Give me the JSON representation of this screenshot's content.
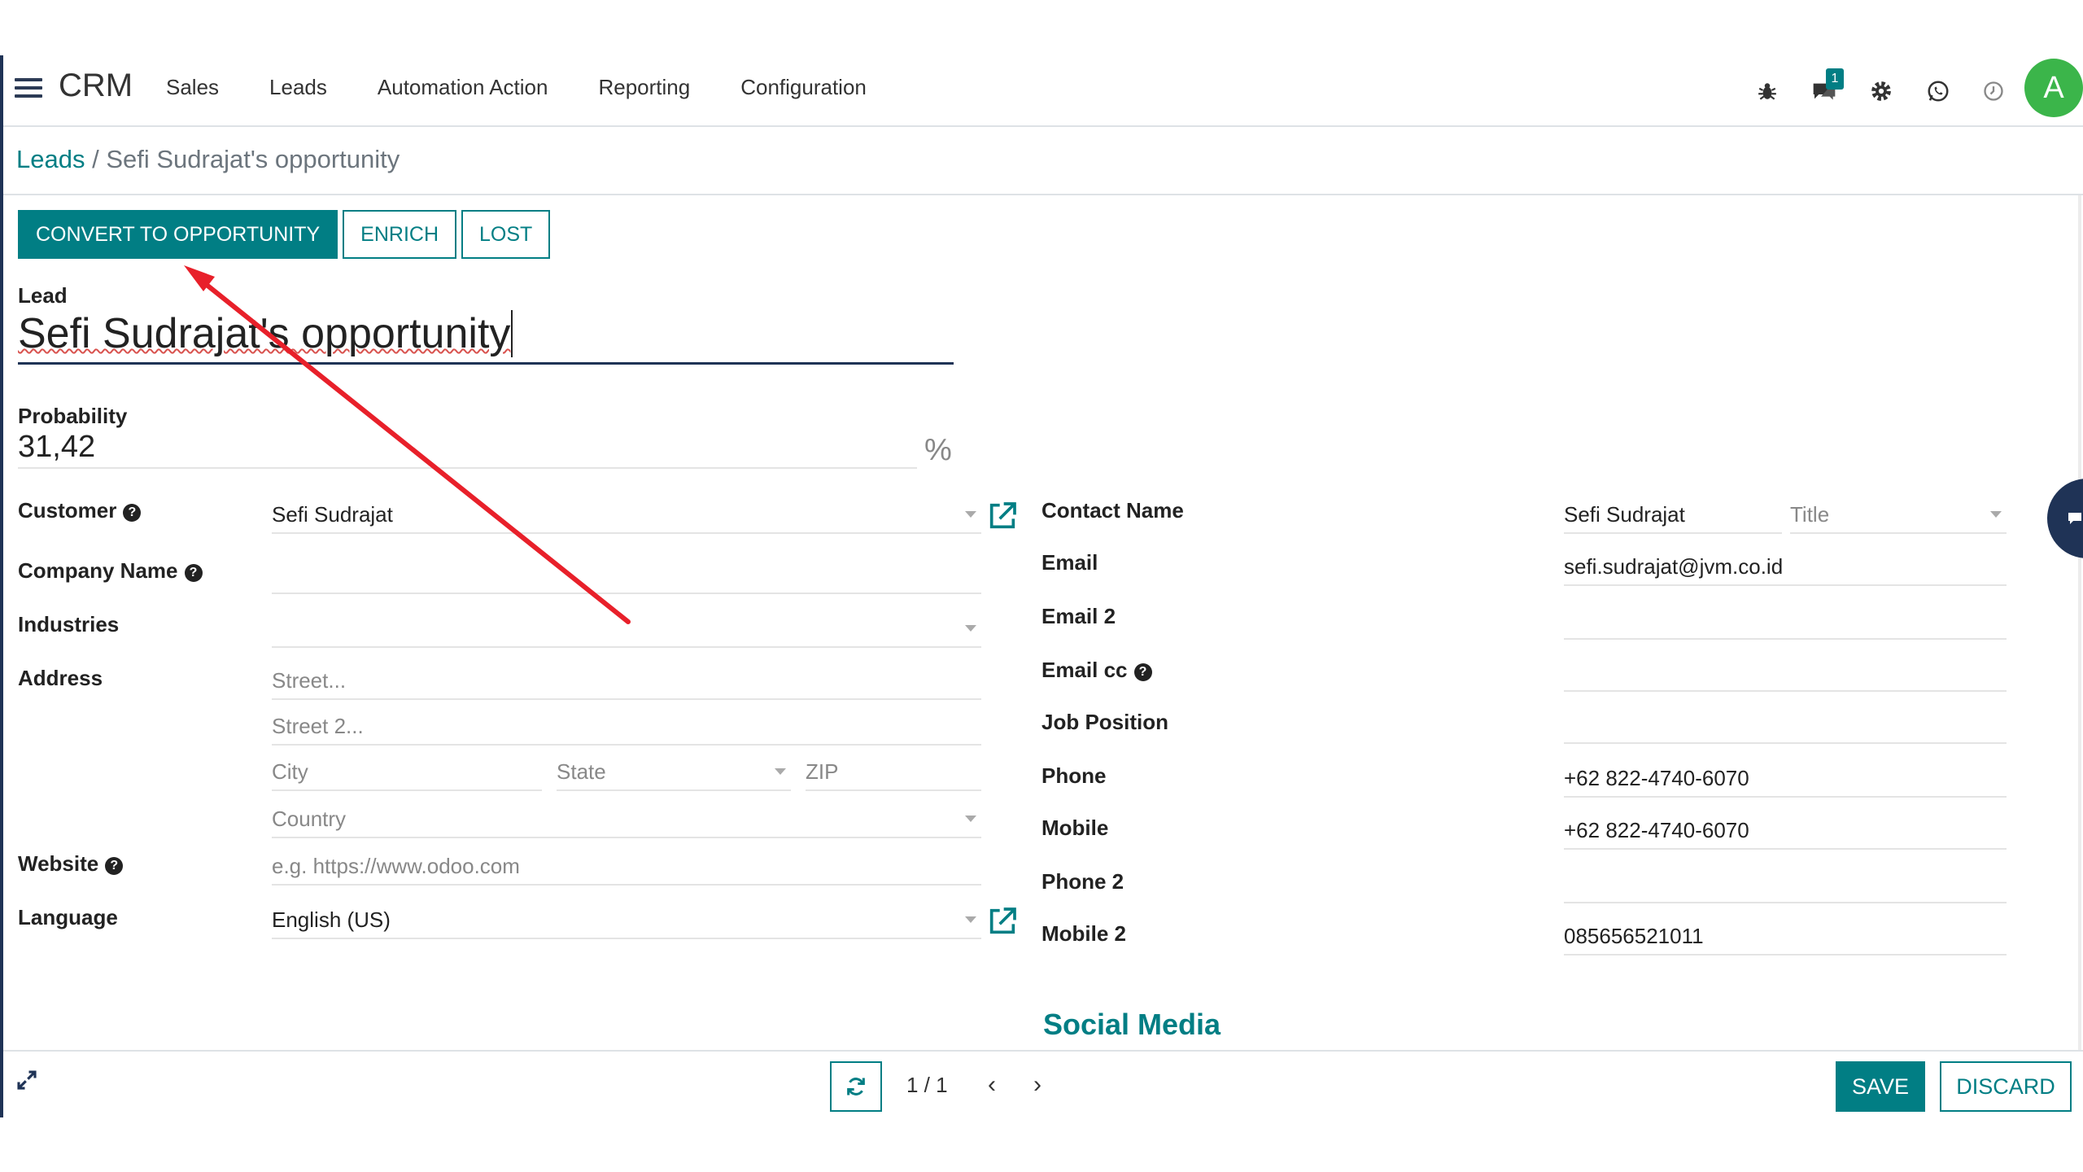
{
  "app": {
    "brand": "CRM",
    "menu": [
      "Sales",
      "Leads",
      "Automation Action",
      "Reporting",
      "Configuration"
    ],
    "avatar_letter": "A",
    "messages_count": "1"
  },
  "breadcrumb": {
    "parent": "Leads",
    "separator": "/",
    "current": "Sefi Sudrajat's opportunity"
  },
  "statusbar": {
    "convert": "CONVERT TO OPPORTUNITY",
    "enrich": "ENRICH",
    "lost": "LOST"
  },
  "form": {
    "lead_label": "Lead",
    "lead_name": "Sefi Sudrajat's opportunity",
    "probability_label": "Probability",
    "probability": "31,42",
    "probability_suffix": "%",
    "left": {
      "customer_label": "Customer",
      "customer": "Sefi Sudrajat",
      "company_label": "Company Name",
      "company": "",
      "industries_label": "Industries",
      "industries": "",
      "address_label": "Address",
      "street_ph": "Street...",
      "street2_ph": "Street 2...",
      "city_ph": "City",
      "state_ph": "State",
      "zip_ph": "ZIP",
      "country_ph": "Country",
      "website_label": "Website",
      "website_ph": "e.g. https://www.odoo.com",
      "language_label": "Language",
      "language": "English (US)"
    },
    "right": {
      "contact_label": "Contact Name",
      "contact": "Sefi Sudrajat",
      "title_ph": "Title",
      "email_label": "Email",
      "email": "sefi.sudrajat@jvm.co.id",
      "email2_label": "Email 2",
      "email2": "",
      "emailcc_label": "Email cc",
      "emailcc": "",
      "job_label": "Job Position",
      "job": "",
      "phone_label": "Phone",
      "phone": "+62 822-4740-6070",
      "mobile_label": "Mobile",
      "mobile": "+62 822-4740-6070",
      "phone2_label": "Phone 2",
      "phone2": "",
      "mobile2_label": "Mobile 2",
      "mobile2": "085656521011"
    },
    "social_title": "Social Media"
  },
  "pager": {
    "value": "1 / 1",
    "prev": "‹",
    "next": "›"
  },
  "buttons": {
    "save": "SAVE",
    "discard": "DISCARD"
  },
  "colors": {
    "primary": "#017e84",
    "navy": "#1f3356",
    "annotation_arrow": "#e8202a",
    "avatar": "#3bb54a"
  }
}
